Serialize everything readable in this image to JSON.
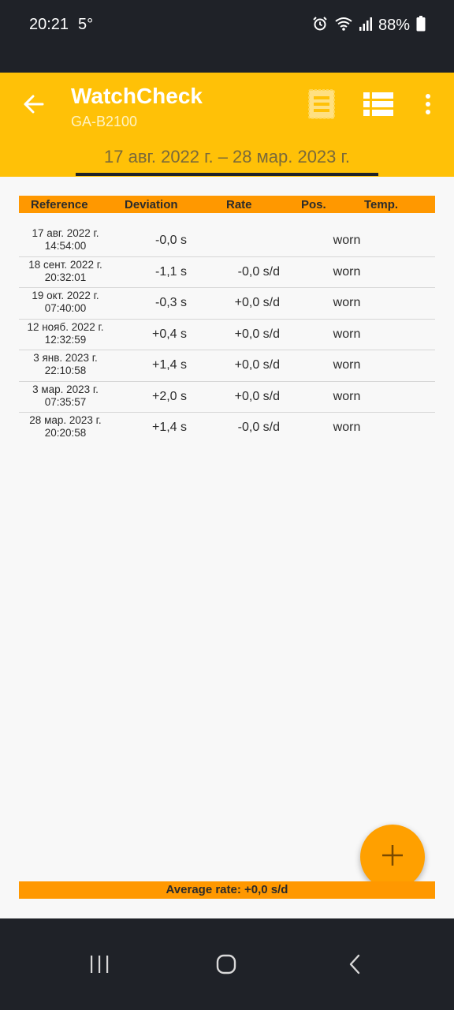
{
  "status_bar": {
    "time": "20:21",
    "temperature": "5°",
    "battery": "88%",
    "icons": [
      "alarm-icon",
      "wifi-icon",
      "signal-icon",
      "battery-icon"
    ]
  },
  "app_bar": {
    "title": "WatchCheck",
    "subtitle": "GA-B2100",
    "accent_color": "#ffc107"
  },
  "date_range": {
    "label": "17 авг. 2022 г. – 28 мар. 2023 г."
  },
  "table": {
    "headers": {
      "reference": "Reference",
      "deviation": "Deviation",
      "rate": "Rate",
      "pos": "Pos.",
      "temp": "Temp."
    },
    "rows": [
      {
        "date": "17 авг. 2022 г.",
        "time": "14:54:00",
        "deviation": "-0,0 s",
        "rate": "",
        "pos": "worn"
      },
      {
        "date": "18 сент. 2022 г.",
        "time": "20:32:01",
        "deviation": "-1,1 s",
        "rate": "-0,0 s/d",
        "pos": "worn"
      },
      {
        "date": "19 окт. 2022 г.",
        "time": "07:40:00",
        "deviation": "-0,3 s",
        "rate": "+0,0 s/d",
        "pos": "worn"
      },
      {
        "date": "12 нояб. 2022 г.",
        "time": "12:32:59",
        "deviation": "+0,4 s",
        "rate": "+0,0 s/d",
        "pos": "worn"
      },
      {
        "date": "3 янв. 2023 г.",
        "time": "22:10:58",
        "deviation": "+1,4 s",
        "rate": "+0,0 s/d",
        "pos": "worn"
      },
      {
        "date": "3 мар. 2023 г.",
        "time": "07:35:57",
        "deviation": "+2,0 s",
        "rate": "+0,0 s/d",
        "pos": "worn"
      },
      {
        "date": "28 мар. 2023 г.",
        "time": "20:20:58",
        "deviation": "+1,4 s",
        "rate": "-0,0 s/d",
        "pos": "worn"
      }
    ]
  },
  "footer": {
    "average_rate": "Average rate: +0,0 s/d"
  },
  "fab": {
    "icon": "plus-icon"
  },
  "nav_bar": {
    "icons": [
      "recent-apps-icon",
      "home-icon",
      "back-icon"
    ]
  }
}
